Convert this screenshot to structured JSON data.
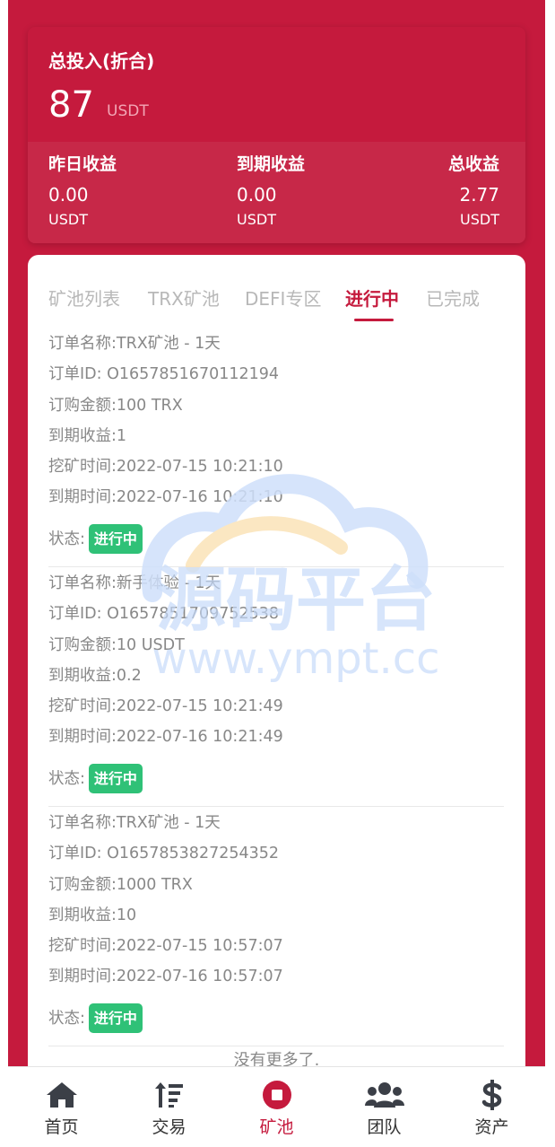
{
  "summary": {
    "title": "总投入(折合)",
    "total": "87",
    "unit": "USDT",
    "stats": [
      {
        "label": "昨日收益",
        "value": "0.00",
        "unit": "USDT"
      },
      {
        "label": "到期收益",
        "value": "0.00",
        "unit": "USDT"
      },
      {
        "label": "总收益",
        "value": "2.77",
        "unit": "USDT"
      }
    ]
  },
  "tabs": [
    "矿池列表",
    "TRX矿池",
    "DEFI专区",
    "进行中",
    "已完成"
  ],
  "active_tab": "进行中",
  "orders": [
    {
      "name": "订单名称:TRX矿池 - 1天",
      "id": "订单ID: O1657851670112194",
      "amount": "订购金额:100 TRX",
      "income": "到期收益:1",
      "start": "挖矿时间:2022-07-15 10:21:10",
      "end": "到期时间:2022-07-16 10:21:10",
      "status_label": "状态:",
      "status": "进行中"
    },
    {
      "name": "订单名称:新手体验 - 1天",
      "id": "订单ID: O1657851709752538",
      "amount": "订购金额:10 USDT",
      "income": "到期收益:0.2",
      "start": "挖矿时间:2022-07-15 10:21:49",
      "end": "到期时间:2022-07-16 10:21:49",
      "status_label": "状态:",
      "status": "进行中"
    },
    {
      "name": "订单名称:TRX矿池 - 1天",
      "id": "订单ID: O1657853827254352",
      "amount": "订购金额:1000 TRX",
      "income": "到期收益:10",
      "start": "挖矿时间:2022-07-15 10:57:07",
      "end": "到期时间:2022-07-16 10:57:07",
      "status_label": "状态:",
      "status": "进行中"
    }
  ],
  "no_more": "没有更多了.",
  "watermark": {
    "text": "源码平台",
    "url": "www.ympt.cc"
  },
  "nav": [
    {
      "label": "首页",
      "icon": "home-icon"
    },
    {
      "label": "交易",
      "icon": "sort-icon"
    },
    {
      "label": "矿池",
      "icon": "stop-circle-icon"
    },
    {
      "label": "团队",
      "icon": "users-icon"
    },
    {
      "label": "资产",
      "icon": "dollar-icon"
    }
  ],
  "active_nav": "矿池",
  "colors": {
    "brand": "#c51a3d",
    "success": "#2fc177"
  }
}
